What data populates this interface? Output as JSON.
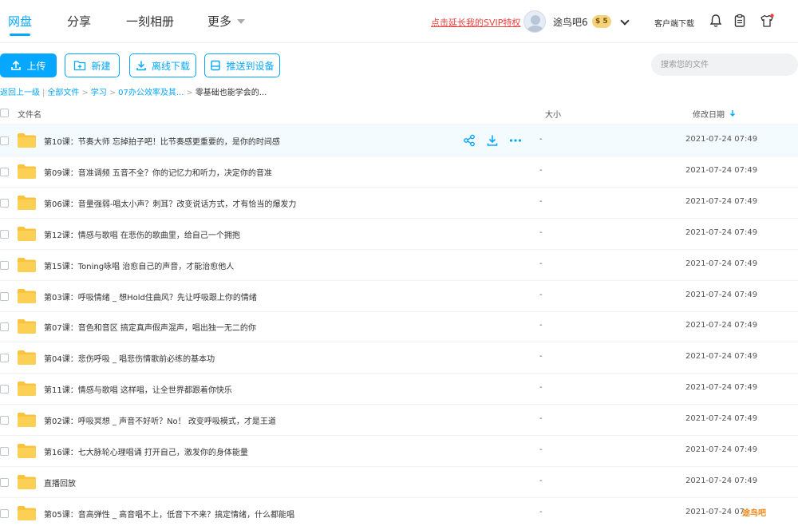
{
  "nav": {
    "items": [
      {
        "label": "网盘",
        "active": true
      },
      {
        "label": "分享"
      },
      {
        "label": "一刻相册"
      },
      {
        "label": "更多"
      }
    ],
    "promo": "点击延长我的SVIP特权",
    "username": "途鸟吧6",
    "vip_badge": "$ 5",
    "client_download": "客户端下载",
    "icons": [
      "bell-icon",
      "clipboard-icon",
      "shirt-icon"
    ]
  },
  "toolbar": {
    "upload": "上传",
    "new": "新建",
    "offline_download": "离线下载",
    "push_to_device": "推送到设备",
    "search_placeholder": "搜索您的文件"
  },
  "breadcrumb": {
    "back": "返回上一级",
    "all_files": "全部文件",
    "study": "学习",
    "office": "07办公效率及其...",
    "current": "零基础也能学会的..."
  },
  "table": {
    "col_name": "文件名",
    "col_size": "大小",
    "col_date": "修改日期",
    "rows": [
      {
        "name": "第10课：节奏大师 忘掉拍子吧！比节奏感更重要的，是你的时间感",
        "size": "-",
        "date": "2021-07-24 07:49"
      },
      {
        "name": "第09课：音准调频 五音不全？你的记忆力和听力，决定你的音准",
        "size": "-",
        "date": "2021-07-24 07:49"
      },
      {
        "name": "第06课：音量强弱-唱太小声？刺耳？改变说话方式，才有恰当的爆发力",
        "size": "-",
        "date": "2021-07-24 07:49"
      },
      {
        "name": "第12课：情感与歌唱 在悲伤的歌曲里，给自己一个拥抱",
        "size": "-",
        "date": "2021-07-24 07:49"
      },
      {
        "name": "第15课：Toning咏唱 治愈自己的声音，才能治愈他人",
        "size": "-",
        "date": "2021-07-24 07:49"
      },
      {
        "name": "第03课：呼吸情绪 _ 想Hold住曲风？先让呼吸跟上你的情绪",
        "size": "-",
        "date": "2021-07-24 07:49"
      },
      {
        "name": "第07课：音色和音区 搞定真声假声混声，唱出独一无二的你",
        "size": "-",
        "date": "2021-07-24 07:49"
      },
      {
        "name": "第04课：悲伤呼吸 _ 唱悲伤情歌前必练的基本功",
        "size": "-",
        "date": "2021-07-24 07:49"
      },
      {
        "name": "第11课：情感与歌唱 这样唱，让全世界都跟着你快乐",
        "size": "-",
        "date": "2021-07-24 07:49"
      },
      {
        "name": "第02课：呼吸冥想 _ 声音不好听？No！ 改变呼吸模式，才是王道",
        "size": "-",
        "date": "2021-07-24 07:49"
      },
      {
        "name": "第16课：七大脉轮心理唱诵 打开自己，激发你的身体能量",
        "size": "-",
        "date": "2021-07-24 07:49"
      },
      {
        "name": "直播回放",
        "size": "-",
        "date": "2021-07-24 07:49"
      },
      {
        "name": "第05课：音高弹性 _ 高音唱不上，低音下不来？搞定情绪，什么都能唱",
        "size": "-",
        "date": "2021-07-24 07"
      }
    ]
  },
  "watermark": "途鸟吧",
  "colors": {
    "accent": "#06a7ff",
    "promo": "#f0403f",
    "folder": "#f9c33d",
    "row_hover": "#f4fbff"
  }
}
